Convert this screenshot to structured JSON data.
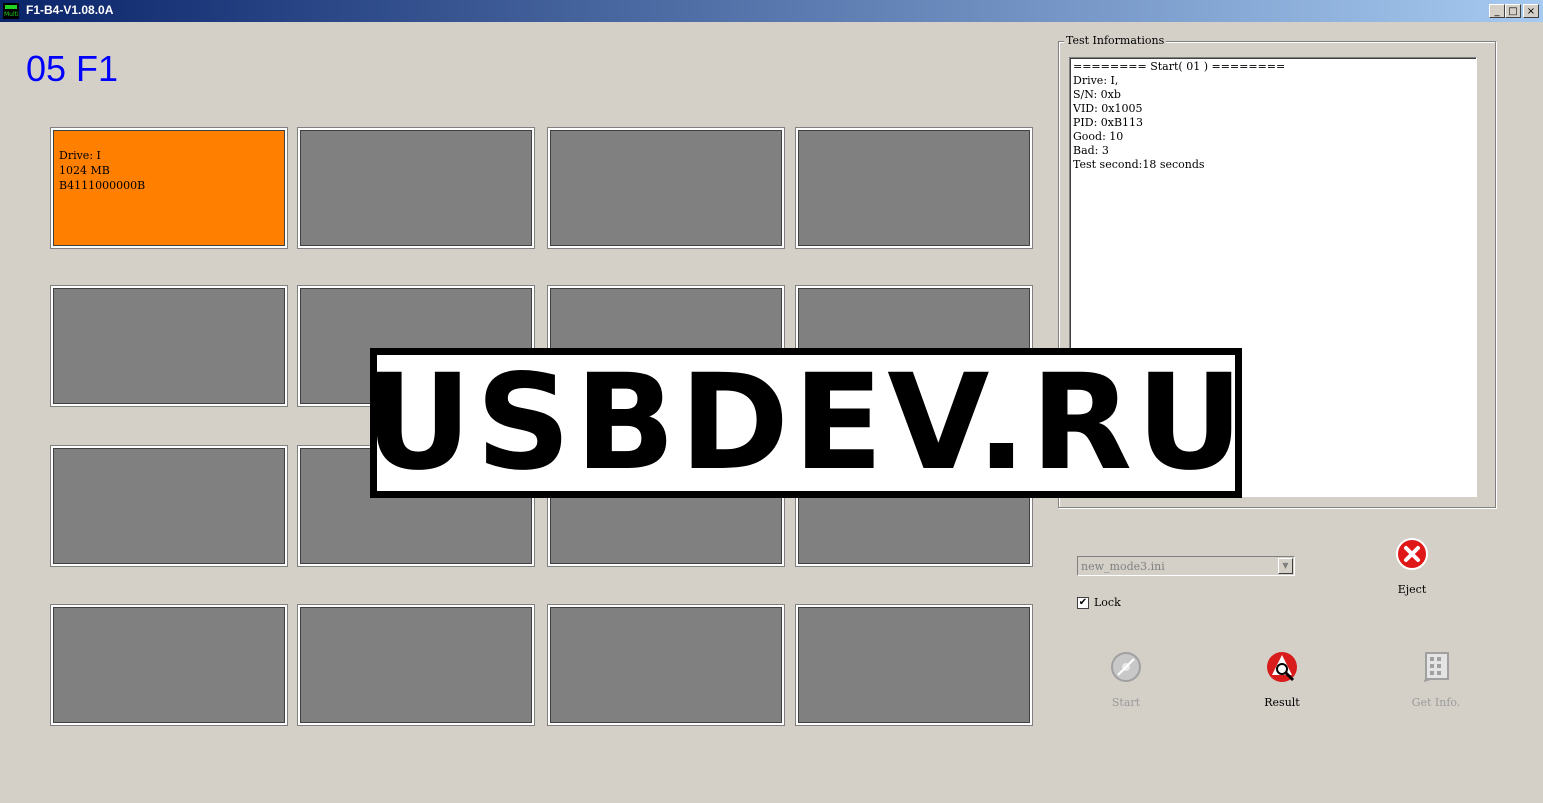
{
  "window": {
    "title": "F1-B4-V1.08.0A",
    "icon_text": "Multi",
    "controls": {
      "minimize": "_",
      "maximize": "□",
      "close": "×"
    }
  },
  "counter": "05 F1",
  "slots": [
    {
      "lines": [
        "Drive: I",
        "1024 MB",
        "B4111000000B"
      ],
      "status": "active"
    },
    {
      "lines": []
    },
    {
      "lines": []
    },
    {
      "lines": []
    },
    {
      "lines": []
    },
    {
      "lines": []
    },
    {
      "lines": []
    },
    {
      "lines": []
    },
    {
      "lines": []
    },
    {
      "lines": []
    },
    {
      "lines": []
    },
    {
      "lines": []
    },
    {
      "lines": []
    },
    {
      "lines": []
    },
    {
      "lines": []
    },
    {
      "lines": []
    }
  ],
  "test_info": {
    "group_label": "Test Informations",
    "lines": [
      "======== Start( 01 ) ========",
      "Drive: I,",
      "S/N: 0xb",
      "VID: 0x1005",
      "PID: 0xB113",
      "Good: 10",
      "Bad: 3",
      "Test second:18 seconds"
    ]
  },
  "mode_select": {
    "value": "new_mode3.ini"
  },
  "lock": {
    "label": "Lock",
    "checked": true,
    "mark": "✔"
  },
  "buttons": {
    "eject": "Eject",
    "start": "Start",
    "result": "Result",
    "get_info": "Get Info."
  },
  "colors": {
    "active_slot": "#ff8000",
    "empty_slot": "#808080",
    "counter": "#0000ff"
  },
  "watermark": "USBDEV.RU"
}
